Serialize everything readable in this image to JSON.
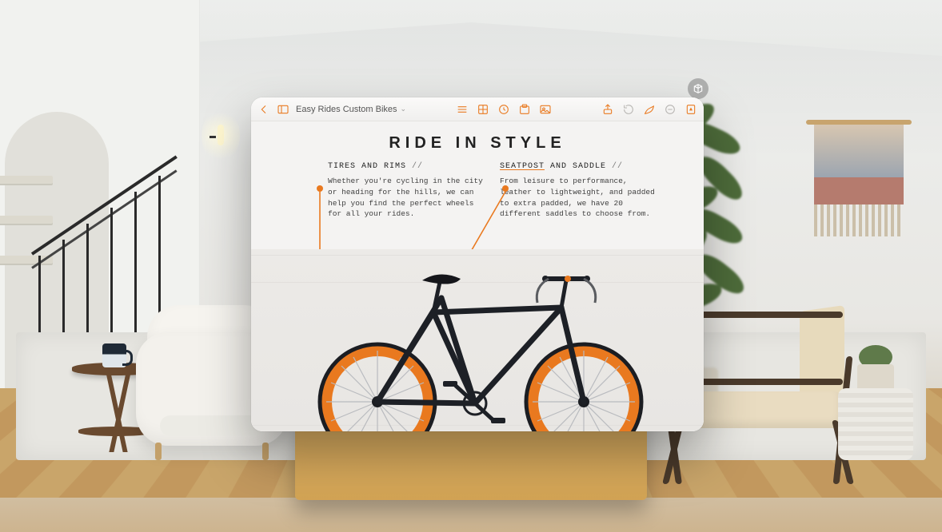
{
  "colors": {
    "accent": "#e9791f"
  },
  "spatial_control": {
    "icon": "object-capture-icon"
  },
  "window": {
    "doc_title": "Easy Rides Custom Bikes",
    "toolbar": {
      "back": "Back",
      "sidebar": "Sidebar",
      "view_list": "List view",
      "view_grid": "Grid view",
      "recent": "Recent",
      "insert": "Insert",
      "media": "Media",
      "share": "Share",
      "history": "History",
      "draw": "Draw",
      "collapse": "Collapse",
      "format": "Format"
    }
  },
  "document": {
    "heading": "RIDE IN STYLE",
    "callouts": [
      {
        "title_main": "TIRES AND RIMS",
        "title_sep": " // ",
        "body": "Whether you're cycling in the city or heading for the hills, we can help you find the perfect wheels for all your rides.",
        "underline": false
      },
      {
        "title_main": "SEATPOST",
        "title_rest": " AND SADDLE",
        "title_sep": " // ",
        "body": "From leisure to performance, leather to lightweight, and padded to extra padded, we have 20 different saddles to choose from.",
        "underline": true
      }
    ]
  }
}
